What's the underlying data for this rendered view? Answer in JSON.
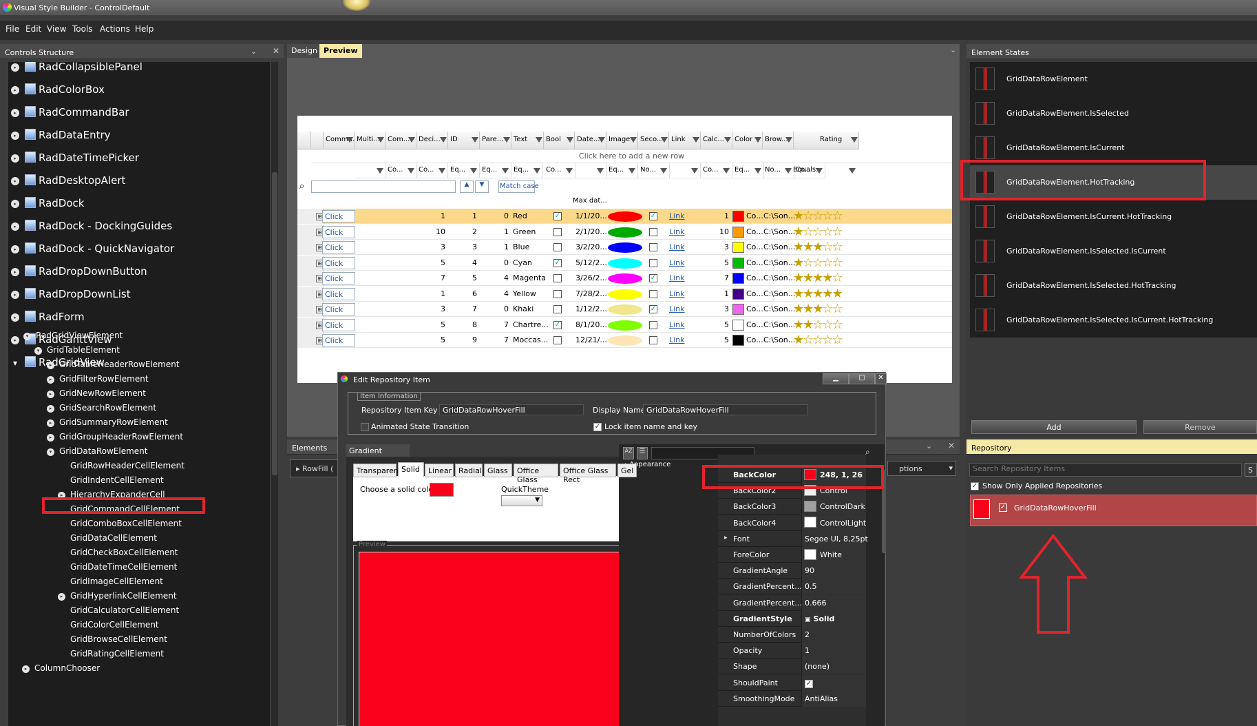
{
  "window": {
    "title": "Visual Style Builder - ControlDefault"
  },
  "menu": [
    "File",
    "Edit",
    "View",
    "Tools",
    "Actions",
    "Help"
  ],
  "controls_structure": {
    "title": "Controls Structure",
    "top_items": [
      "RadCollapsiblePanel",
      "RadColorBox",
      "RadCommandBar",
      "RadDataEntry",
      "RadDateTimePicker",
      "RadDesktopAlert",
      "RadDock",
      "RadDock - DockingGuides",
      "RadDock - QuickNavigator",
      "RadDropDownButton",
      "RadDropDownList",
      "RadForm",
      "RadGanttView",
      "RadGridView"
    ],
    "sub_items": [
      "RadGridViewElement",
      "GridTableElement",
      "GridTableHeaderRowElement",
      "GridFilterRowElement",
      "GridNewRowElement",
      "GridSearchRowElement",
      "GridSummaryRowElement",
      "GridGroupHeaderRowElement",
      "GridDataRowElement",
      "GridRowHeaderCellElement",
      "GridIndentCellElement",
      "HierarchyExpanderCell",
      "GridCommandCellElement",
      "GridComboBoxCellElement",
      "GridDataCellElement",
      "GridCheckBoxCellElement",
      "GridDateTimeCellElement",
      "GridImageCellElement",
      "GridHyperlinkCellElement",
      "GridCalculatorCellElement",
      "GridColorCellElement",
      "GridBrowseCellElement",
      "GridRatingCellElement",
      "ColumnChooser"
    ]
  },
  "doc_tabs": {
    "design": "Design",
    "preview": "Preview"
  },
  "grid": {
    "headers": [
      "Comma...",
      "Multi...",
      "Com...",
      "Deci...",
      "ID",
      "Pare...",
      "Text",
      "Bool",
      "Date...",
      "Image",
      "Seco...",
      "Link",
      "Calc...",
      "Color",
      "Brow...",
      "Rating"
    ],
    "new_row": "Click here to add a new row",
    "filter_labels": [
      "Co...",
      "Co...",
      "Eq...",
      "Eq...",
      "Eq...",
      "Co...",
      "Eq...",
      "No...",
      "Co...",
      "Eq...",
      "No...",
      "Co...",
      "Equals:"
    ],
    "search": {
      "match_case": "Match case"
    },
    "max_label": "Max dat...",
    "rows": [
      {
        "btn": "Click",
        "dec": "1",
        "id": "1",
        "par": "0",
        "text": "Red",
        "bool": true,
        "date": "1/1/20...",
        "img": "#ff0000",
        "sec": true,
        "link": "Link",
        "calc": "1",
        "color": "#ff0000",
        "cval": "Co...",
        "brow": "C:\\Son...",
        "rating": 1
      },
      {
        "btn": "Click",
        "dec": "10",
        "id": "2",
        "par": "1",
        "text": "Green",
        "bool": false,
        "date": "2/1/20...",
        "img": "#00aa00",
        "sec": false,
        "link": "Link",
        "calc": "10",
        "color": "#ff9900",
        "cval": "Co...",
        "brow": "C:\\Son...",
        "rating": 1
      },
      {
        "btn": "Click",
        "dec": "3",
        "id": "3",
        "par": "1",
        "text": "Blue",
        "bool": false,
        "date": "3/2/20...",
        "img": "#0000ff",
        "sec": false,
        "link": "Link",
        "calc": "3",
        "color": "#ffff00",
        "cval": "Co...",
        "brow": "C:\\Son...",
        "rating": 3
      },
      {
        "btn": "Click",
        "dec": "5",
        "id": "4",
        "par": "0",
        "text": "Cyan",
        "bool": true,
        "date": "5/12/2...",
        "img": "#00ffff",
        "sec": false,
        "link": "Link",
        "calc": "5",
        "color": "#00bb00",
        "cval": "Co...",
        "brow": "C:\\Son...",
        "rating": 1
      },
      {
        "btn": "Click",
        "dec": "7",
        "id": "5",
        "par": "4",
        "text": "Magenta",
        "bool": false,
        "date": "3/26/2...",
        "img": "#ff00ff",
        "sec": true,
        "link": "Link",
        "calc": "7",
        "color": "#0000ff",
        "cval": "Co...",
        "brow": "C:\\Son...",
        "rating": 4
      },
      {
        "btn": "Click",
        "dec": "1",
        "id": "6",
        "par": "4",
        "text": "Yellow",
        "bool": false,
        "date": "7/28/2...",
        "img": "#ffff00",
        "sec": false,
        "link": "Link",
        "calc": "1",
        "color": "#440088",
        "cval": "Co...",
        "brow": "C:\\Son...",
        "rating": 5
      },
      {
        "btn": "Click",
        "dec": "3",
        "id": "7",
        "par": "0",
        "text": "Khaki",
        "bool": false,
        "date": "1/12/2...",
        "img": "#f0e68c",
        "sec": true,
        "link": "Link",
        "calc": "3",
        "color": "#ee66ee",
        "cval": "Co...",
        "brow": "C:\\Son...",
        "rating": 3
      },
      {
        "btn": "Click",
        "dec": "5",
        "id": "8",
        "par": "7",
        "text": "Chartre...",
        "bool": true,
        "date": "8/1/20...",
        "img": "#7fff00",
        "sec": false,
        "link": "Link",
        "calc": "5",
        "color": "#ffffff",
        "cval": "Co...",
        "brow": "C:\\Son...",
        "rating": 2
      },
      {
        "btn": "Click",
        "dec": "5",
        "id": "9",
        "par": "7",
        "text": "Moccas...",
        "bool": false,
        "date": "12/21/...",
        "img": "#ffe4b5",
        "sec": false,
        "link": "Link",
        "calc": "5",
        "color": "#000000",
        "cval": "Co...",
        "brow": "C:\\Son...",
        "rating": 1
      }
    ]
  },
  "element_states": {
    "title": "Element States",
    "items": [
      "GridDataRowElement",
      "GridDataRowElement.IsSelected",
      "GridDataRowElement.IsCurrent",
      "GridDataRowElement.HotTracking",
      "GridDataRowElement.IsCurrent.HotTracking",
      "GridDataRowElement.IsSelected.IsCurrent",
      "GridDataRowElement.IsSelected.HotTracking",
      "GridDataRowElement.IsSelected.IsCurrent.HotTracking"
    ],
    "add": "Add",
    "remove": "Remove"
  },
  "repository": {
    "title": "Repository",
    "search_placeholder": "Search Repository Items",
    "show_only": "Show Only Applied Repositories",
    "item": "GridDataRowHoverFill",
    "item_color": "#f8011a"
  },
  "elements_panel": {
    "title": "Elements",
    "row": "RowFill (",
    "options": "ptions"
  },
  "dialog": {
    "title": "Edit Repository Item",
    "info_group": "Item Information",
    "key_label": "Repository Item Key :",
    "key_value": "GridDataRowHoverFill",
    "display_label": "Display Name :",
    "display_value": "GridDataRowHoverFill",
    "animated": "Animated State Transition",
    "lock": "Lock item name and key",
    "gradient_title": "Gradient Properties",
    "tabs": [
      "Transparent",
      "Solid",
      "Linear",
      "Radial",
      "Glass",
      "Office Glass",
      "Office Glass Rect",
      "Gel"
    ],
    "choose": "Choose a solid color:",
    "quicktheme": "QuickTheme",
    "preview": "Preview",
    "fill_color": "#f8011a",
    "category": "Appearance",
    "props": [
      {
        "name": "BackColor",
        "value": "248, 1, 26",
        "swatch": "#f8011a",
        "bold": true
      },
      {
        "name": "BackColor2",
        "value": "Control",
        "swatch": "#f0f0f0"
      },
      {
        "name": "BackColor3",
        "value": "ControlDark",
        "swatch": "#a0a0a0"
      },
      {
        "name": "BackColor4",
        "value": "ControlLight",
        "swatch": "#ffffff"
      },
      {
        "name": "Font",
        "value": "Segoe UI, 8,25pt"
      },
      {
        "name": "ForeColor",
        "value": "White",
        "swatch": "#ffffff"
      },
      {
        "name": "GradientAngle",
        "value": "90"
      },
      {
        "name": "GradientPercent...",
        "value": "0.5"
      },
      {
        "name": "GradientPercent...",
        "value": "0.666"
      },
      {
        "name": "GradientStyle",
        "value": "Solid",
        "bold": true
      },
      {
        "name": "NumberOfColors",
        "value": "2"
      },
      {
        "name": "Opacity",
        "value": "1"
      },
      {
        "name": "Shape",
        "value": "(none)"
      },
      {
        "name": "ShouldPaint",
        "value": "✓"
      },
      {
        "name": "SmoothingMode",
        "value": "AntiAlias"
      }
    ]
  }
}
